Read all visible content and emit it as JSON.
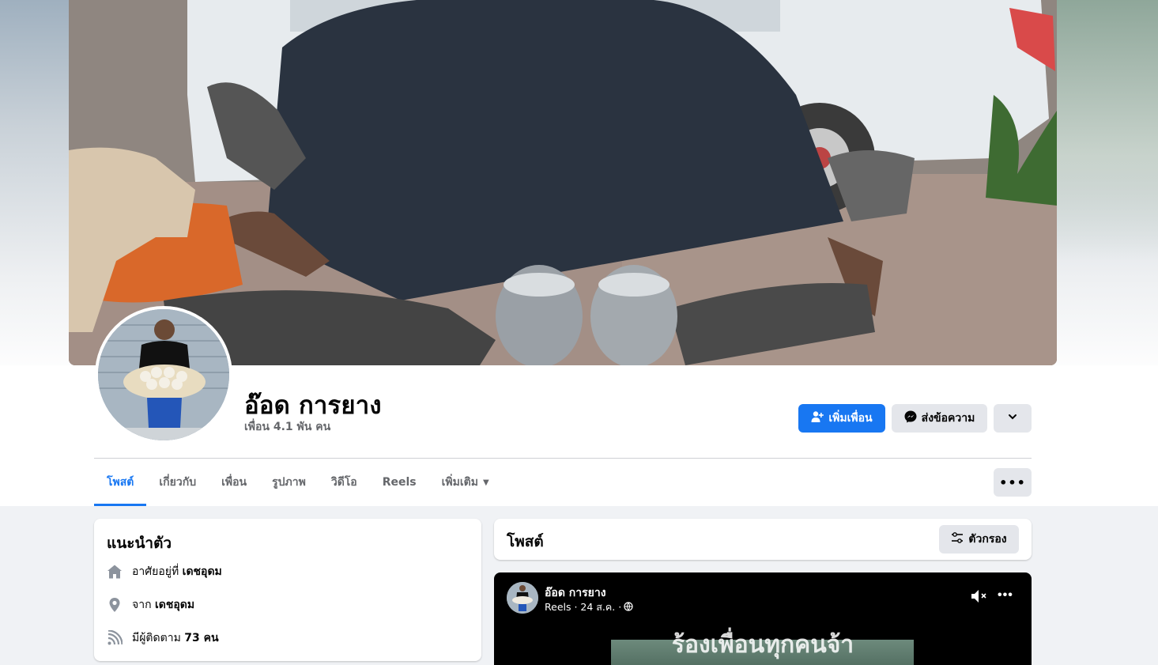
{
  "profile": {
    "name": "อ๊อด การยาง",
    "friends_count": "เพื่อน 4.1 พัน คน"
  },
  "actions": {
    "add_friend": "เพิ่มเพื่อน",
    "message": "ส่งข้อความ"
  },
  "tabs": [
    {
      "label": "โพสต์",
      "active": true
    },
    {
      "label": "เกี่ยวกับ"
    },
    {
      "label": "เพื่อน"
    },
    {
      "label": "รูปภาพ"
    },
    {
      "label": "วิดีโอ"
    },
    {
      "label": "Reels"
    },
    {
      "label": "เพิ่มเติม"
    }
  ],
  "intro": {
    "title": "แนะนำตัว",
    "lives_prefix": "อาศัยอยู่ที่",
    "lives_value": "เดชอุดม",
    "from_prefix": "จาก",
    "from_value": "เดชอุดม",
    "followers_prefix": "มีผู้ติดตาม",
    "followers_value": "73 คน"
  },
  "posts": {
    "title": "โพสต์",
    "filter_label": "ตัวกรอง"
  },
  "post": {
    "author": "อ๊อด การยาง",
    "meta": "Reels · 24 ส.ค. ·",
    "caption": "ร้องเพื่อนทุกคนจ้า"
  },
  "colors": {
    "accent": "#1877f2",
    "background": "#f0f2f5",
    "secondary_text": "#65676b"
  }
}
